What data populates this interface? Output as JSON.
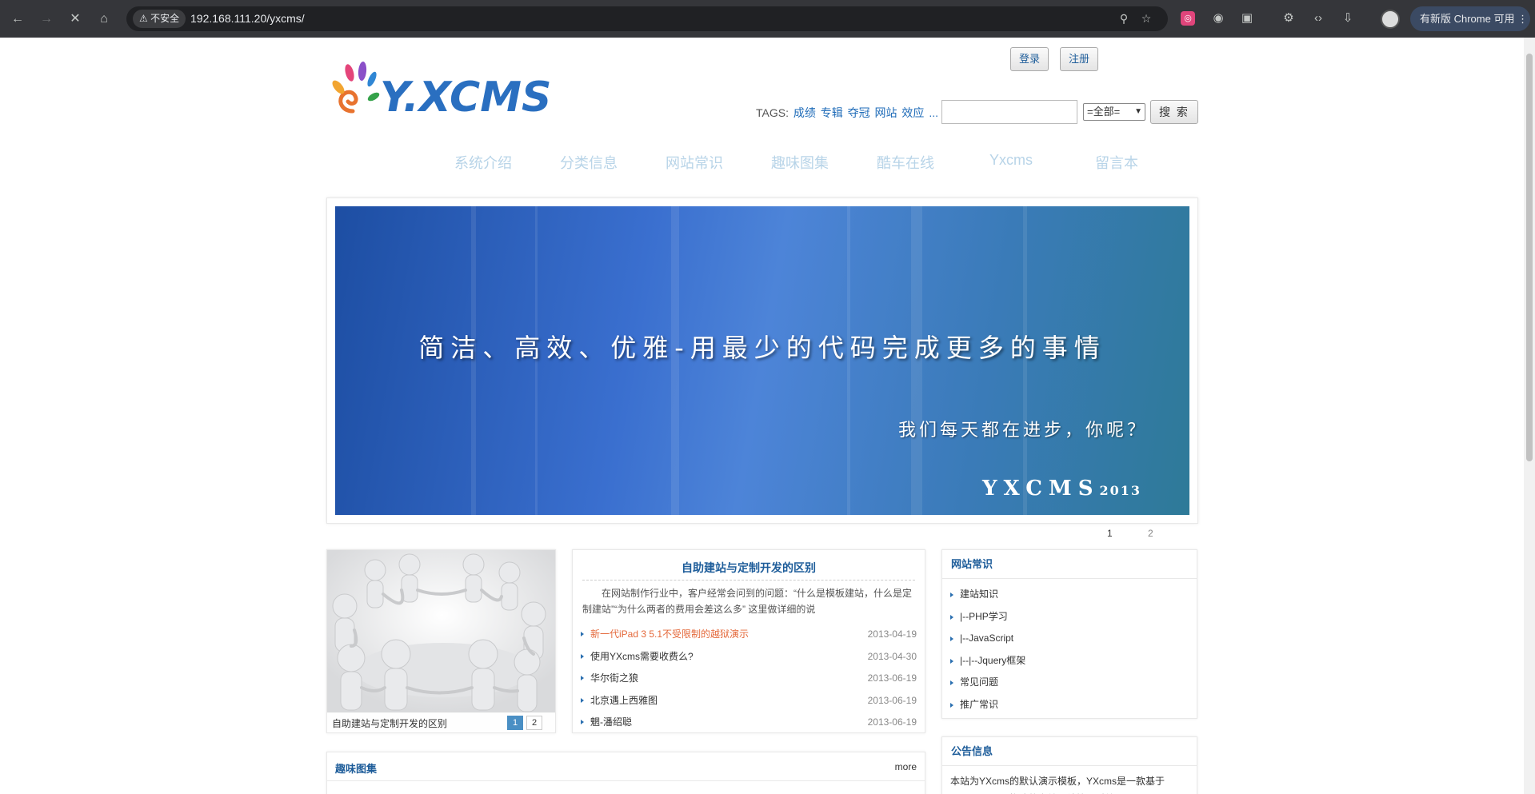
{
  "browser": {
    "insecure_label": "不安全",
    "url": "192.168.111.20/yxcms/",
    "update_label": "有新版 Chrome 可用"
  },
  "header": {
    "login": "登录",
    "register": "注册",
    "tags_label": "TAGS:",
    "tags": [
      "成绩",
      "专辑",
      "夺冠",
      "网站",
      "效应",
      "..."
    ],
    "search_select": "=全部=",
    "search_button": "搜 索"
  },
  "nav": [
    "系统介绍",
    "分类信息",
    "网站常识",
    "趣味图集",
    "酷车在线",
    "Yxcms",
    "留言本"
  ],
  "banner": {
    "headline": "简洁、高效、优雅-用最少的代码完成更多的事情",
    "sub": "我们每天都在进步，你呢？",
    "brand": "YXCMS",
    "brand_year": "2013",
    "pages": [
      "1",
      "2"
    ]
  },
  "gallery": {
    "caption": "自助建站与定制开发的区别",
    "pages": [
      "1",
      "2"
    ]
  },
  "news": {
    "title": "自助建站与定制开发的区别",
    "excerpt": "在网站制作行业中，客户经常会问到的问题：“什么是模板建站，什么是定制建站”“为什么两者的费用会差这么多” 这里做详细的说",
    "items": [
      {
        "title": "新一代iPad 3 5.1不受限制的越狱演示",
        "date": "2013-04-19"
      },
      {
        "title": "使用YXcms需要收费么?",
        "date": "2013-04-30"
      },
      {
        "title": "华尔街之狼",
        "date": "2013-06-19"
      },
      {
        "title": "北京遇上西雅图",
        "date": "2013-06-19"
      },
      {
        "title": "魍-潘绍聪",
        "date": "2013-06-19"
      }
    ]
  },
  "sidebar": {
    "knowledge_title": "网站常识",
    "knowledge_items": [
      "建站知识",
      "|--PHP学习",
      "|--JavaScript",
      "|--|--Jquery框架",
      "常见问题",
      "推广常识"
    ],
    "notice_title": "公告信息",
    "notice_text": "本站为YXcms的默认演示模板，YXcms是一款基于PHP+MYSQL构建的高效网站管理系统。"
  },
  "fun": {
    "title": "趣味图集",
    "more": "more"
  },
  "colors": {
    "link_blue": "#1e5d9a",
    "hot_orange": "#e4683a",
    "nav_faint": "#b8d4e8"
  }
}
